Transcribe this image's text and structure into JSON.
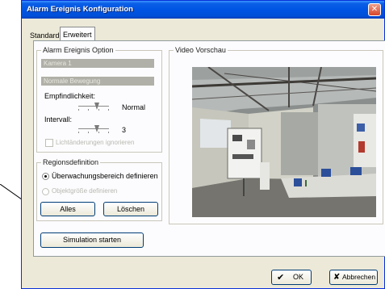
{
  "window": {
    "title": "Alarm Ereignis Konfiguration",
    "close_label": "✕"
  },
  "tabs": [
    {
      "label": "Standard",
      "selected": false
    },
    {
      "label": "Erweitert",
      "selected": true
    }
  ],
  "alarm_option": {
    "legend": "Alarm Ereignis Option",
    "camera_field": "Kamera 1",
    "motion_field": "Normale Bewegung",
    "sensitivity_label": "Empfindlichkeit:",
    "sensitivity_value": "Normal",
    "interval_label": "Intervall:",
    "interval_value": "3",
    "checkbox_label": "Lichtänderungen ignorieren"
  },
  "region": {
    "legend": "Regionsdefinition",
    "radio1_label": "Überwachungsbereich definieren",
    "radio2_label": "Objektgröße definieren",
    "all_button": "Alles",
    "delete_button": "Löschen"
  },
  "video": {
    "legend": "Video Vorschau"
  },
  "simulation_button": "Simulation starten",
  "ok_button": "OK",
  "cancel_button": "Abbrechen",
  "icons": {
    "ok": "checkmark-icon",
    "cancel": "x-icon"
  },
  "colors": {
    "titlebar": "#0054e3",
    "close": "#d6452a",
    "window_bg": "#ece9d8"
  }
}
